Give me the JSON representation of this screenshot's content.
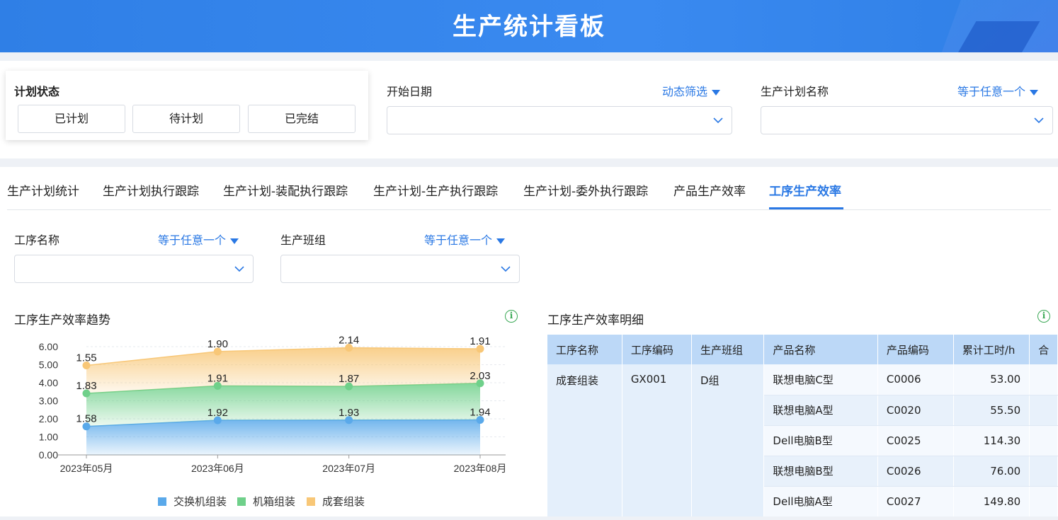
{
  "header": {
    "title": "生产统计看板"
  },
  "plan_status": {
    "title": "计划状态",
    "buttons": [
      "已计划",
      "待计划",
      "已完结"
    ]
  },
  "filters": {
    "start_date": {
      "label": "开始日期",
      "operator": "动态筛选",
      "value": ""
    },
    "plan_name": {
      "label": "生产计划名称",
      "operator": "等于任意一个",
      "value": ""
    }
  },
  "tabs": [
    {
      "label": "生产计划统计"
    },
    {
      "label": "生产计划执行跟踪"
    },
    {
      "label": "生产计划-装配执行跟踪"
    },
    {
      "label": "生产计划-生产执行跟踪"
    },
    {
      "label": "生产计划-委外执行跟踪"
    },
    {
      "label": "产品生产效率"
    },
    {
      "label": "工序生产效率",
      "active": true
    }
  ],
  "sub_filters": {
    "process_name": {
      "label": "工序名称",
      "operator": "等于任意一个",
      "value": ""
    },
    "team": {
      "label": "生产班组",
      "operator": "等于任意一个",
      "value": ""
    }
  },
  "trend_panel": {
    "title": "工序生产效率趋势"
  },
  "detail_panel": {
    "title": "工序生产效率明细"
  },
  "chart_data": {
    "type": "area",
    "stacked": true,
    "categories": [
      "2023年05月",
      "2023年06月",
      "2023年07月",
      "2023年08月"
    ],
    "yticks": [
      "0.00",
      "1.00",
      "2.00",
      "3.00",
      "4.00",
      "5.00",
      "6.00"
    ],
    "ylim": [
      0,
      6
    ],
    "series": [
      {
        "name": "交换机组装",
        "values": [
          1.58,
          1.92,
          1.93,
          1.94
        ],
        "color": "#5aa9ea"
      },
      {
        "name": "机箱组装",
        "values": [
          1.83,
          1.91,
          1.87,
          2.03
        ],
        "color": "#6fd08a"
      },
      {
        "name": "成套组装",
        "values": [
          1.55,
          1.9,
          2.14,
          1.91
        ],
        "color": "#f8c777"
      }
    ],
    "legend_position": "bottom"
  },
  "table": {
    "columns": [
      "工序名称",
      "工序编码",
      "生产班组",
      "产品名称",
      "产品编码",
      "累计工时/h",
      "合"
    ],
    "group": {
      "process_name": "成套组装",
      "process_code": "GX001",
      "team": "D组"
    },
    "rows": [
      {
        "product": "联想电脑C型",
        "code": "C0006",
        "hours": "53.00"
      },
      {
        "product": "联想电脑A型",
        "code": "C0020",
        "hours": "55.50"
      },
      {
        "product": "Dell电脑B型",
        "code": "C0025",
        "hours": "114.30"
      },
      {
        "product": "联想电脑B型",
        "code": "C0026",
        "hours": "76.00"
      },
      {
        "product": "Dell电脑A型",
        "code": "C0027",
        "hours": "149.80"
      }
    ]
  },
  "icons": {
    "info": "info-icon",
    "chevron": "chevron-down-icon",
    "dropdown": "caret-down-icon"
  },
  "colors": {
    "accent": "#2a78e4",
    "header": "#2f7fe6",
    "info": "#3aa855",
    "table_header": "#bcd8f7"
  }
}
